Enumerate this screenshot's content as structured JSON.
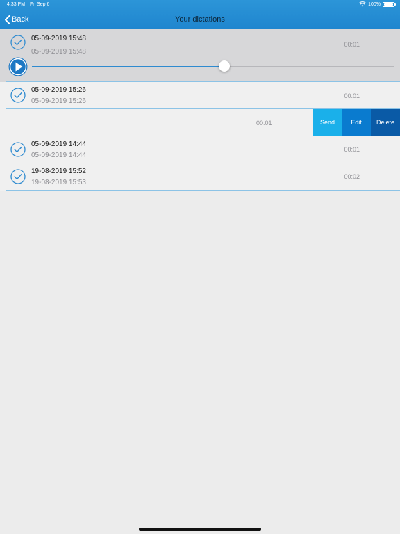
{
  "status_bar": {
    "time": "4:33 PM",
    "date": "Fri Sep 6",
    "battery": "100%"
  },
  "nav": {
    "back_label": "Back",
    "title": "Your dictations"
  },
  "dictations": [
    {
      "title": "05-09-2019 15:48",
      "subtitle": "05-09-2019 15:48",
      "duration": "00:01",
      "selected": true,
      "playback_progress": 0.53
    },
    {
      "title": "05-09-2019 15:26",
      "subtitle": "05-09-2019 15:26",
      "duration": "00:01"
    },
    {
      "duration": "00:01",
      "actions": [
        "Send",
        "Edit",
        "Delete"
      ]
    },
    {
      "title": "05-09-2019 14:44",
      "subtitle": "05-09-2019 14:44",
      "duration": "00:01"
    },
    {
      "title": "19-08-2019 15:52",
      "subtitle": "19-08-2019 15:53",
      "duration": "00:02"
    }
  ],
  "colors": {
    "nav_bar": "#2c95d8",
    "accent": "#2f8bd0",
    "send": "#1ab0ea",
    "edit": "#0a7bcf",
    "delete": "#0a5aa6",
    "separator": "#8cc3e6"
  }
}
